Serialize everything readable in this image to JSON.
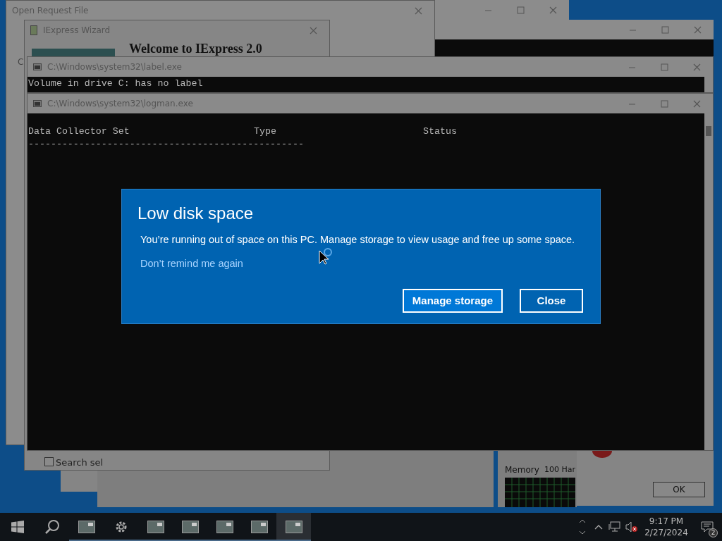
{
  "windows": [
    {
      "kind": "dialog",
      "title": "Open Request File",
      "left_label": "C"
    },
    {
      "kind": "wizard",
      "title": "IExpress Wizard",
      "heading": "Welcome to IExpress 2.0"
    },
    {
      "kind": "console",
      "title": "C:\\Windows\\system32\\label.exe",
      "lines": [
        "Volume in drive C: has no label"
      ]
    },
    {
      "kind": "console",
      "title": "C:\\Windows\\system32\\logman.exe",
      "columns": [
        "Data Collector Set",
        "Type",
        "Status"
      ],
      "rule": "-------------------------------------------------"
    }
  ],
  "background": {
    "checkbox_label": "Search sel",
    "checked": false,
    "memory_label": "Memory",
    "memory_value": "100 Har",
    "ok_button": "OK"
  },
  "alert": {
    "title": "Low disk space",
    "message": "You’re running out of space on this PC. Manage storage to view usage and free up some space.",
    "link": "Don’t remind me again",
    "buttons": [
      {
        "label": "Manage storage",
        "selected": true
      },
      {
        "label": "Close",
        "selected": false
      }
    ]
  },
  "taskbar": {
    "apps": [
      {
        "kind": "window",
        "active": false
      },
      {
        "kind": "settings",
        "active": false
      },
      {
        "kind": "window",
        "active": false
      },
      {
        "kind": "window",
        "active": false
      },
      {
        "kind": "window",
        "active": false
      },
      {
        "kind": "window",
        "active": false
      },
      {
        "kind": "window",
        "active": true
      }
    ],
    "time": "9:17 PM",
    "date": "2/27/2024",
    "notifications": "2"
  }
}
